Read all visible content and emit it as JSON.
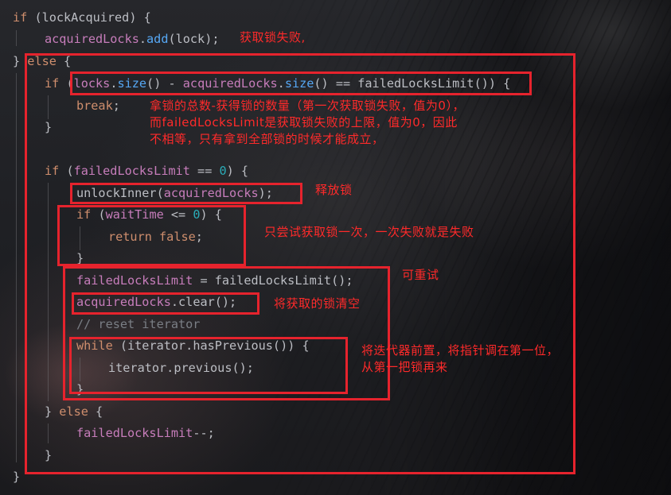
{
  "code": {
    "l1": {
      "if": "if",
      "open": " (",
      "var": "lockAcquired",
      "close": ") {"
    },
    "l2": {
      "obj": "acquiredLocks",
      "dot": ".",
      "method": "add",
      "p1": "(",
      "arg": "lock",
      "p2": ");"
    },
    "l3": {
      "brace": "}",
      "else": " else",
      "open": " {"
    },
    "l4": {
      "if": "if",
      "p0": " (",
      "locks": "locks",
      "d1": ".",
      "size1": "size",
      "pp1": "()",
      "minus": " - ",
      "acq": "acquiredLocks",
      "d2": ".",
      "size2": "size",
      "pp2": "()",
      "eq": " == ",
      "limit": "failedLocksLimit",
      "p3": "())",
      "open": " {"
    },
    "l5": {
      "kw": "break",
      "semi": ";"
    },
    "l6": {
      "brace": "}"
    },
    "l8": {
      "if": "if",
      "p0": " (",
      "var": "failedLocksLimit",
      "eq": " == ",
      "num": "0",
      "close": ") {"
    },
    "l9": {
      "fn": "unlockInner",
      "p1": "(",
      "arg": "acquiredLocks",
      "p2": ");"
    },
    "l10": {
      "if": "if",
      "p0": " (",
      "var": "waitTime",
      "le": " <= ",
      "num": "0",
      "close": ") {"
    },
    "l11": {
      "ret": "return",
      "sp": " ",
      "val": "false",
      "semi": ";"
    },
    "l12": {
      "brace": "}"
    },
    "l13": {
      "var": "failedLocksLimit",
      "assign": " = ",
      "fn": "failedLocksLimit",
      "pp": "()",
      "semi": ";"
    },
    "l14": {
      "obj": "acquiredLocks",
      "dot": ".",
      "fn": "clear",
      "pp": "()",
      "semi": ";"
    },
    "l15": {
      "comment": "// reset iterator"
    },
    "l16": {
      "kw": "while",
      "p0": " (",
      "obj": "iterator",
      "dot": ".",
      "fn": "hasPrevious",
      "pp": "())",
      "open": " {"
    },
    "l17": {
      "obj": "iterator",
      "dot": ".",
      "fn": "previous",
      "pp": "()",
      "semi": ";"
    },
    "l18": {
      "brace": "}"
    },
    "l19": {
      "brace": "}",
      "else": " else",
      "open": " {"
    },
    "l20": {
      "var": "failedLocksLimit",
      "op": "--",
      "semi": ";"
    },
    "l21": {
      "brace": "}"
    },
    "l22": {
      "brace": "}"
    }
  },
  "annotations": {
    "acquire_fail": "获取锁失败,",
    "total_note": "拿锁的总数-获得锁的数量（第一次获取锁失败，值为0），\n而failedLocksLimit是获取锁失败的上限，值为0，因此\n不相等，只有拿到全部锁的时候才能成立，",
    "release": "释放锁",
    "try_once": "只尝试获取锁一次，一次失败就是失败",
    "retry": "可重试",
    "clear": "将获取的锁清空",
    "iterator": "将迭代器前置，将指针调在第一位，\n从第一把锁再来"
  },
  "colors": {
    "keyword": "#cf8e6d",
    "field": "#c77dbb",
    "method": "#56a8f5",
    "number": "#2aacb8",
    "comment": "#7a7e85",
    "text": "#bcbec4",
    "annotation": "#e6232d"
  }
}
